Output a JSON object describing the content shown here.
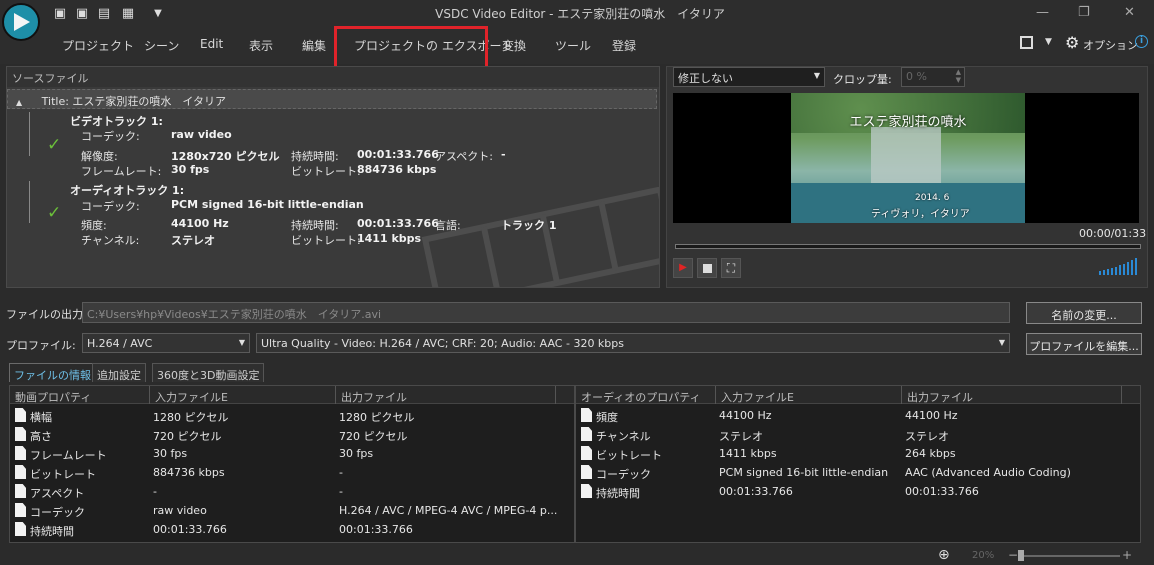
{
  "window": {
    "title": "VSDC Video Editor - エステ家別荘の噴水　イタリア"
  },
  "menu": [
    "プロジェクト",
    "シーン",
    "Edit",
    "表示",
    "編集",
    "プロジェクトの エクスポート",
    "変換",
    "ツール",
    "登録"
  ],
  "toolbar_right": {
    "options_label": "オプション"
  },
  "source": {
    "header": "ソースファイル",
    "title_row": "Title: エステ家別荘の噴水　イタリア",
    "video_track": {
      "heading": "ビデオトラック 1:",
      "codec_label": "コーデック:",
      "codec_value": "raw video",
      "resolution_label": "解像度:",
      "resolution_value": "1280x720 ピクセル",
      "duration_label": "持続時間:",
      "duration_value": "00:01:33.766",
      "aspect_label": "アスペクト:",
      "aspect_value": "-",
      "framerate_label": "フレームレート:",
      "framerate_value": "30 fps",
      "bitrate_label": "ビットレート:",
      "bitrate_value": "884736 kbps"
    },
    "audio_track": {
      "heading": "オーディオトラック 1:",
      "codec_label": "コーデック:",
      "codec_value": "PCM signed 16-bit little-endian",
      "frequency_label": "頻度:",
      "frequency_value": "44100 Hz",
      "duration_label": "持続時間:",
      "duration_value": "00:01:33.766",
      "language_label": "言語:",
      "language_value": "トラック 1",
      "channel_label": "チャンネル:",
      "channel_value": "ステレオ",
      "bitrate_label": "ビットレート:",
      "bitrate_value": "1411 kbps"
    }
  },
  "preview": {
    "correction_select": "修正しない",
    "crop_label": "クロップ量:",
    "crop_value": "0 %",
    "video_caption_top": "エステ家別荘の噴水",
    "video_caption_date": "2014. 6",
    "video_caption_bottom": "ティヴォリ，イタリア",
    "timecode": "00:00/01:33"
  },
  "output": {
    "file_label": "ファイルの出力:",
    "file_path": "C:¥Users¥hp¥Videos¥エステ家別荘の噴水　イタリア.avi",
    "rename_button": "名前の変更...",
    "profile_label": "プロファイル:",
    "profile_format": "H.264 / AVC",
    "profile_preset": "Ultra Quality - Video: H.264 / AVC; CRF: 20; Audio: AAC - 320 kbps",
    "edit_profile_button": "プロファイルを編集..."
  },
  "tabs": [
    "ファイルの情報",
    "追加設定",
    "360度と3D動画設定"
  ],
  "video_props": {
    "headers": [
      "動画プロパティ",
      "入力ファイルE",
      "出力ファイル"
    ],
    "rows": [
      [
        "横幅",
        "1280 ピクセル",
        "1280 ピクセル"
      ],
      [
        "高さ",
        "720 ピクセル",
        "720 ピクセル"
      ],
      [
        "フレームレート",
        "30 fps",
        "30 fps"
      ],
      [
        "ビットレート",
        "884736 kbps",
        "-"
      ],
      [
        "アスペクト",
        "-",
        "-"
      ],
      [
        "コーデック",
        "raw video",
        "H.264 / AVC / MPEG-4 AVC / MPEG-4 p..."
      ],
      [
        "持続時間",
        "00:01:33.766",
        "00:01:33.766"
      ]
    ]
  },
  "audio_props": {
    "headers": [
      "オーディオのプロパティ",
      "入力ファイルE",
      "出力ファイル"
    ],
    "rows": [
      [
        "頻度",
        "44100 Hz",
        "44100 Hz"
      ],
      [
        "チャンネル",
        "ステレオ",
        "ステレオ"
      ],
      [
        "ビットレート",
        "1411 kbps",
        "264 kbps"
      ],
      [
        "コーデック",
        "PCM signed 16-bit little-endian",
        "AAC (Advanced Audio Coding)"
      ],
      [
        "持続時間",
        "00:01:33.766",
        "00:01:33.766"
      ]
    ]
  },
  "status": {
    "zoom": "20%"
  }
}
